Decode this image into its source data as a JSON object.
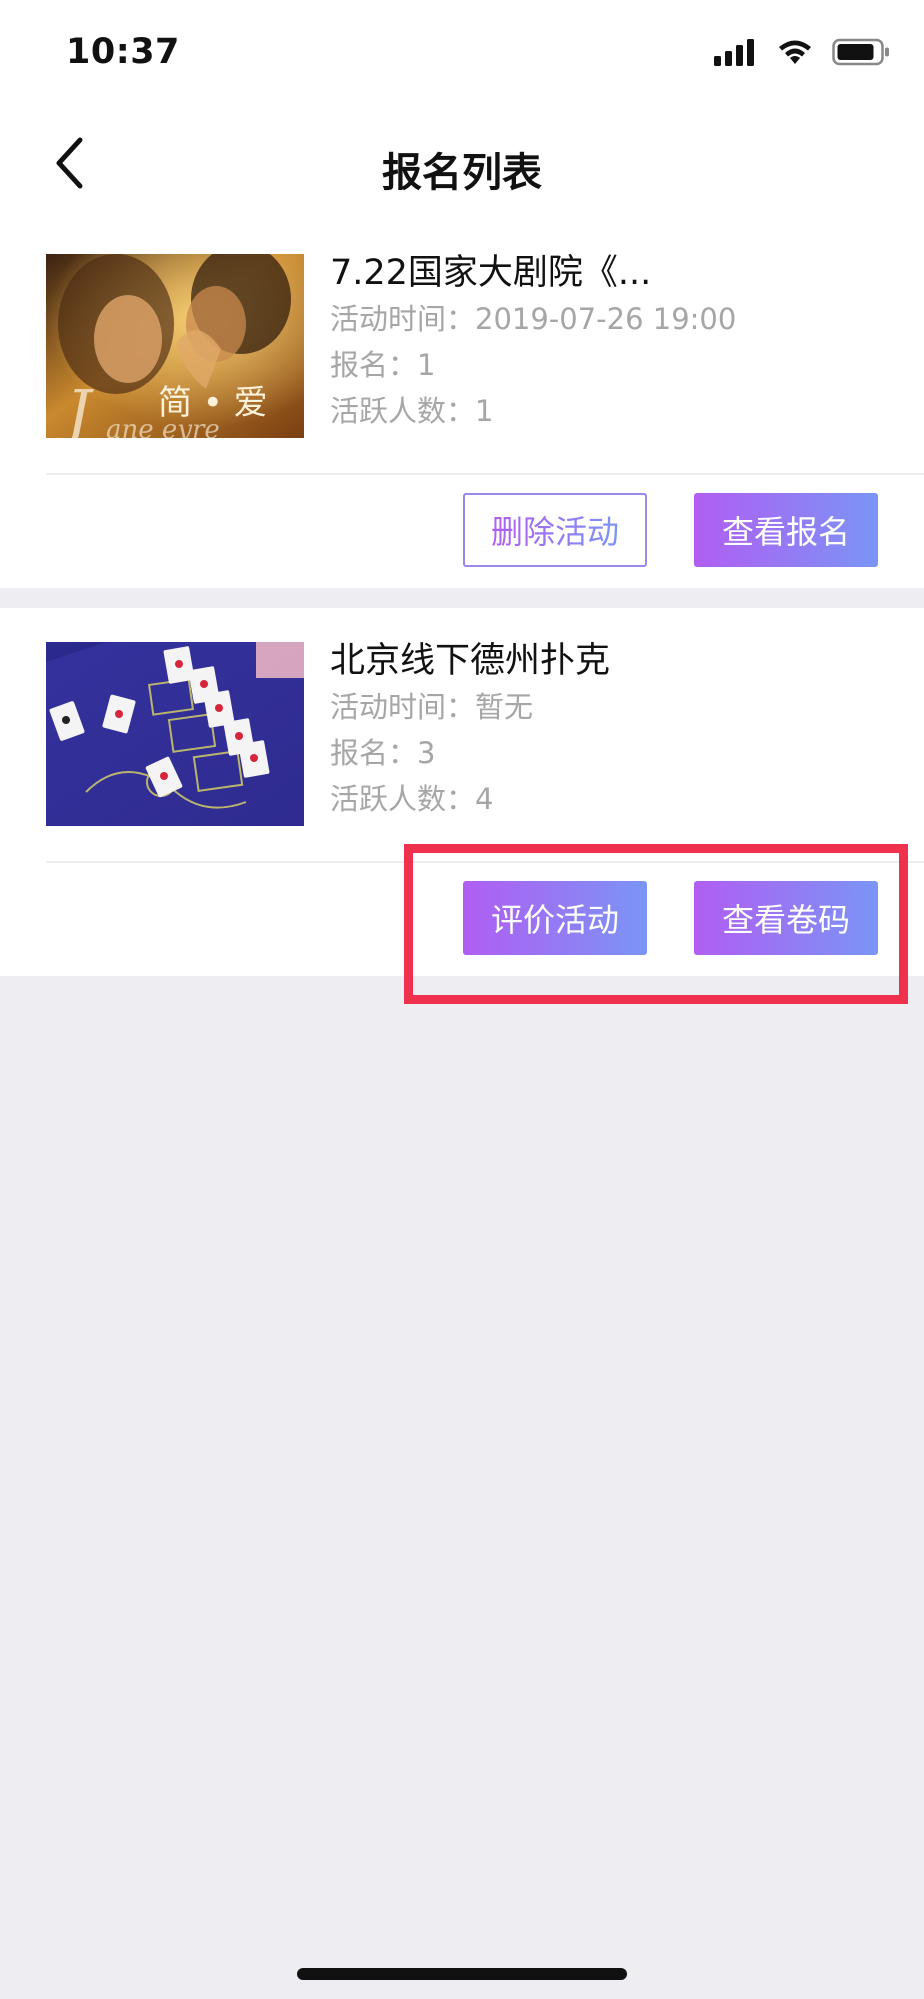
{
  "status_bar": {
    "time": "10:37"
  },
  "nav": {
    "title": "报名列表"
  },
  "activities": [
    {
      "title": "7.22国家大剧院《...",
      "time": "活动时间：2019-07-26 19:00",
      "signups": "报名：1",
      "active": "活跃人数：1",
      "actions": [
        "删除活动",
        "查看报名"
      ]
    },
    {
      "title": "北京线下德州扑克",
      "time": "活动时间：暂无",
      "signups": "报名：3",
      "active": "活跃人数：4",
      "actions": [
        "评价活动",
        "查看卷码"
      ]
    }
  ],
  "image_text": {
    "poster_1": "简 • 爱"
  },
  "theme": {
    "gradient_start": "#B15DF2",
    "gradient_end": "#7A95F6",
    "highlight": "#F0314D",
    "meta_text": "#A6A6A6",
    "background": "#EDEDF2"
  }
}
